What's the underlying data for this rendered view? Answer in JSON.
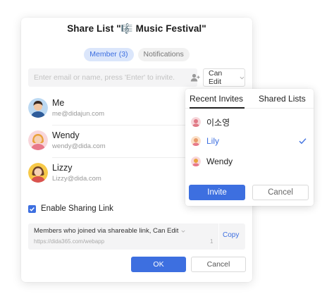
{
  "dialog": {
    "title_prefix": "Share List \"",
    "title_emoji": "🎼",
    "title_name": "Music Festival",
    "title_suffix": "\"",
    "tabs": [
      {
        "label": "Member (3)",
        "active": true
      },
      {
        "label": "Notifications",
        "active": false
      }
    ],
    "invite": {
      "placeholder": "Enter email or name, press 'Enter' to invite.",
      "contacts_icon": "contacts-icon",
      "permission": "Can Edit"
    },
    "members": [
      {
        "name": "Me",
        "email": "me@didajun.com"
      },
      {
        "name": "Wendy",
        "email": "wendy@dida.com"
      },
      {
        "name": "Lizzy",
        "email": "Lizzy@dida.com"
      }
    ],
    "sharing": {
      "enabled": true,
      "label": "Enable Sharing Link",
      "link_description": "Members who joined via shareable link, Can Edit",
      "link_url": "https://dida365.com/webapp",
      "link_count": "1",
      "copy_label": "Copy"
    },
    "ok_label": "OK",
    "cancel_label": "Cancel"
  },
  "popover": {
    "tabs": [
      {
        "label": "Recent Invites",
        "active": true
      },
      {
        "label": "Shared Lists",
        "active": false
      }
    ],
    "items": [
      {
        "name": "이소영",
        "selected": false
      },
      {
        "name": "Lily",
        "selected": true
      },
      {
        "name": "Wendy",
        "selected": false
      }
    ],
    "invite_label": "Invite",
    "cancel_label": "Cancel"
  },
  "colors": {
    "accent": "#3d6fe0",
    "accent_soft": "#dbe6fb"
  }
}
